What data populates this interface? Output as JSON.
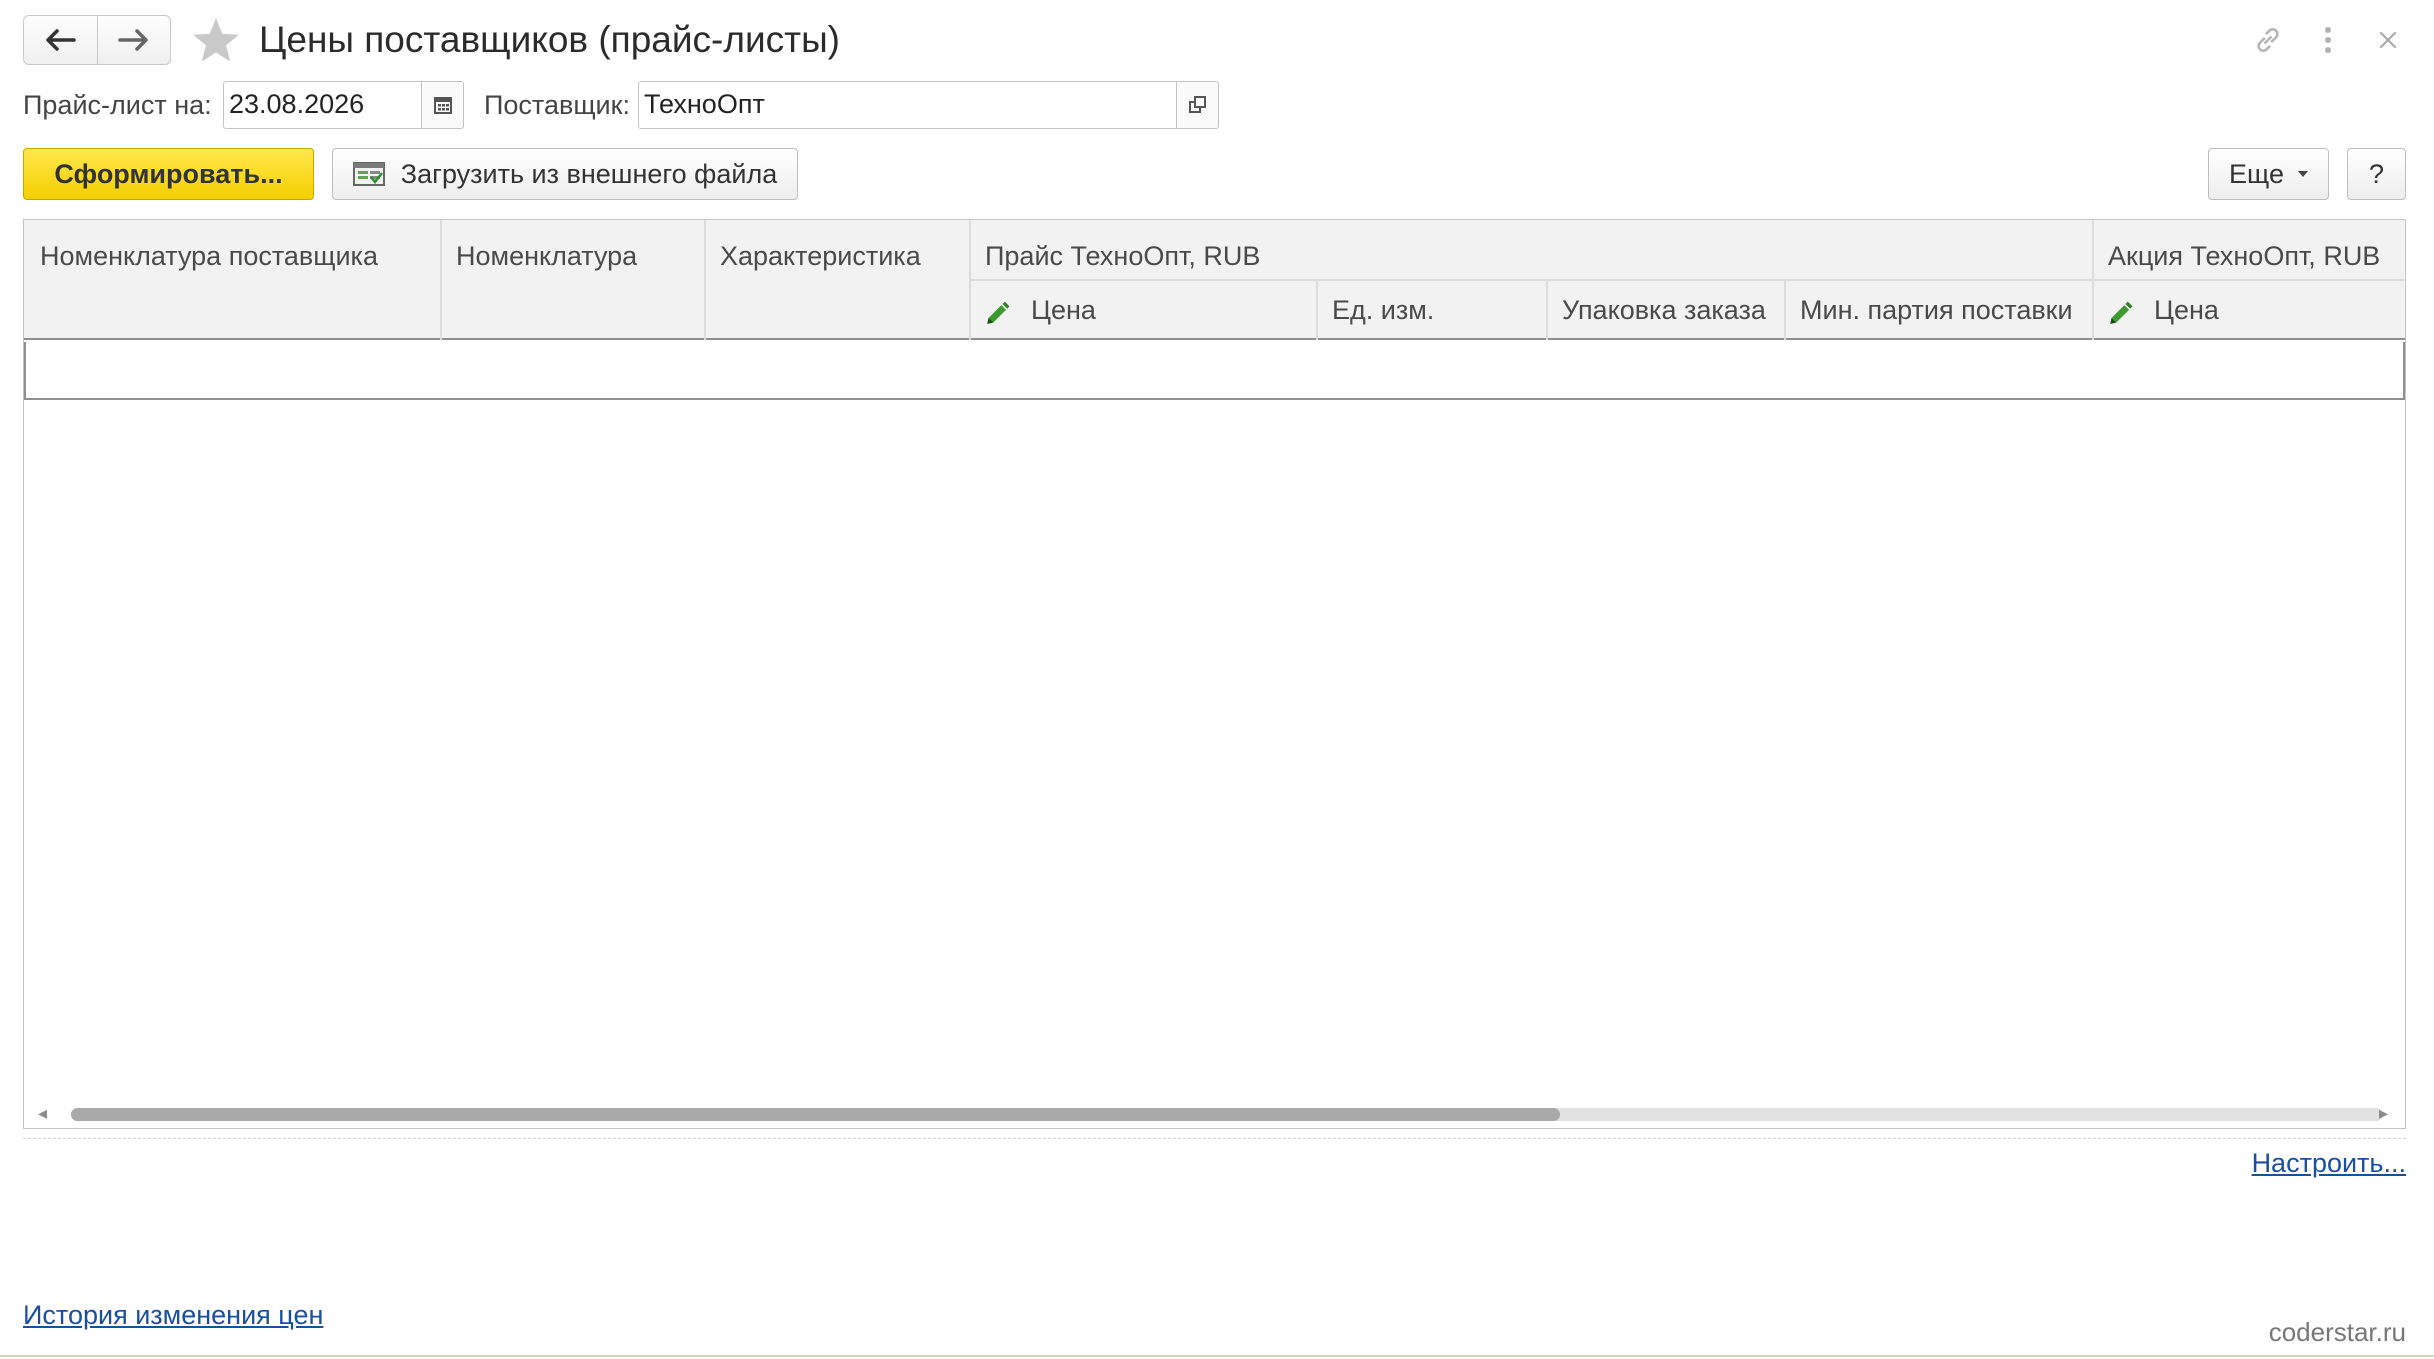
{
  "window": {
    "title": "Цены поставщиков (прайс-листы)",
    "icons": [
      "back-arrow-icon",
      "forward-arrow-icon",
      "favorite-star-icon",
      "link-icon",
      "more-vertical-icon",
      "close-icon"
    ]
  },
  "filters": {
    "date_label": "Прайс-лист на:",
    "date_value": "23.08.2026",
    "supplier_label": "Поставщик:",
    "supplier_value": "ТехноОпт"
  },
  "toolbar": {
    "generate_label": "Сформировать...",
    "load_label": "Загрузить из внешнего файла",
    "more_label": "Еще",
    "help_label": "?"
  },
  "table": {
    "columns": {
      "supplier_nomenclature": "Номенклатура поставщика",
      "nomenclature": "Номенклатура",
      "characteristic": "Характеристика",
      "price_group": "Прайс ТехноОпт, RUB",
      "promo_group": "Акция ТехноОпт, RUB"
    },
    "sub_columns": {
      "price": "Цена",
      "unit": "Ед. изм.",
      "packaging": "Упаковка заказа",
      "min_batch": "Мин. партия поставки",
      "promo_price": "Цена"
    },
    "rows": []
  },
  "footer": {
    "configure_link": "Настроить...",
    "history_link": "История изменения цен",
    "watermark": "coderstar.ru"
  },
  "colors": {
    "primary_button": "#f4cf00",
    "link": "#1a4f9e",
    "pencil": "#3c9a2e"
  }
}
